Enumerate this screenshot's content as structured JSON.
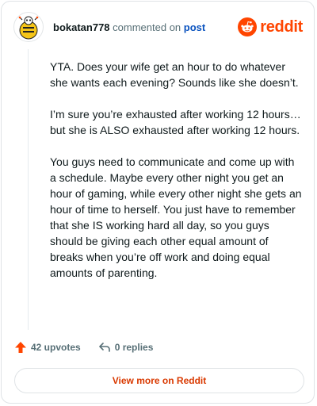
{
  "header": {
    "username": "bokatan778",
    "action_text": " commented on ",
    "post_link": "post",
    "brand": "reddit"
  },
  "comment": {
    "paragraphs": [
      "YTA. Does your wife get an hour to do whatever she wants each evening? Sounds like she doesn’t.",
      "I’m sure you’re exhausted after working 12 hours…but she is ALSO exhausted after working 12 hours.",
      "You guys need to communicate and come up with a schedule. Maybe every other night you get an hour of gaming, while every other night she gets an hour of time to herself. You just have to remember that she IS working hard all day, so you guys should be giving each other equal amount of breaks when you’re off work and doing equal amounts of parenting."
    ]
  },
  "actions": {
    "upvotes": "42 upvotes",
    "replies": "0 replies"
  },
  "cta": {
    "label": "View more on Reddit"
  },
  "colors": {
    "brand": "#ff4500",
    "link": "#0b53bf",
    "upvote": "#ff4500",
    "muted": "#576f76"
  },
  "icons": {
    "avatar": "snoo-avatar-icon",
    "logo": "reddit-snoo-icon",
    "upvote": "upvote-arrow-icon",
    "reply": "reply-arrow-icon"
  }
}
